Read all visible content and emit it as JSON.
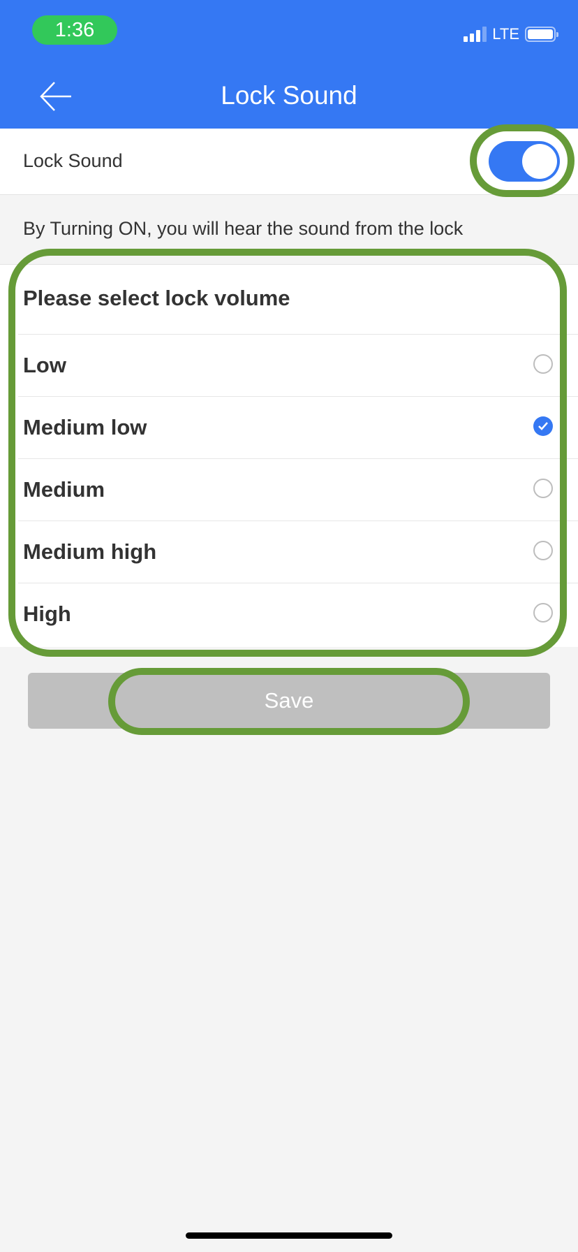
{
  "status_bar": {
    "time": "1:36",
    "network": "LTE",
    "icons": [
      "signal-icon",
      "battery-icon"
    ]
  },
  "header": {
    "title": "Lock Sound",
    "back_icon": "arrow-left-icon"
  },
  "lock_sound": {
    "label": "Lock Sound",
    "enabled": true
  },
  "description": "By Turning ON, you will hear the sound from the lock",
  "volume": {
    "heading": "Please select lock volume",
    "options": [
      {
        "label": "Low",
        "selected": false
      },
      {
        "label": "Medium low",
        "selected": true
      },
      {
        "label": "Medium",
        "selected": false
      },
      {
        "label": "Medium high",
        "selected": false
      },
      {
        "label": "High",
        "selected": false
      }
    ]
  },
  "save_label": "Save",
  "colors": {
    "accent": "#3578f3",
    "time_pill": "#32c85a",
    "annotation": "#669b38",
    "save_disabled": "#bfbfbf"
  }
}
